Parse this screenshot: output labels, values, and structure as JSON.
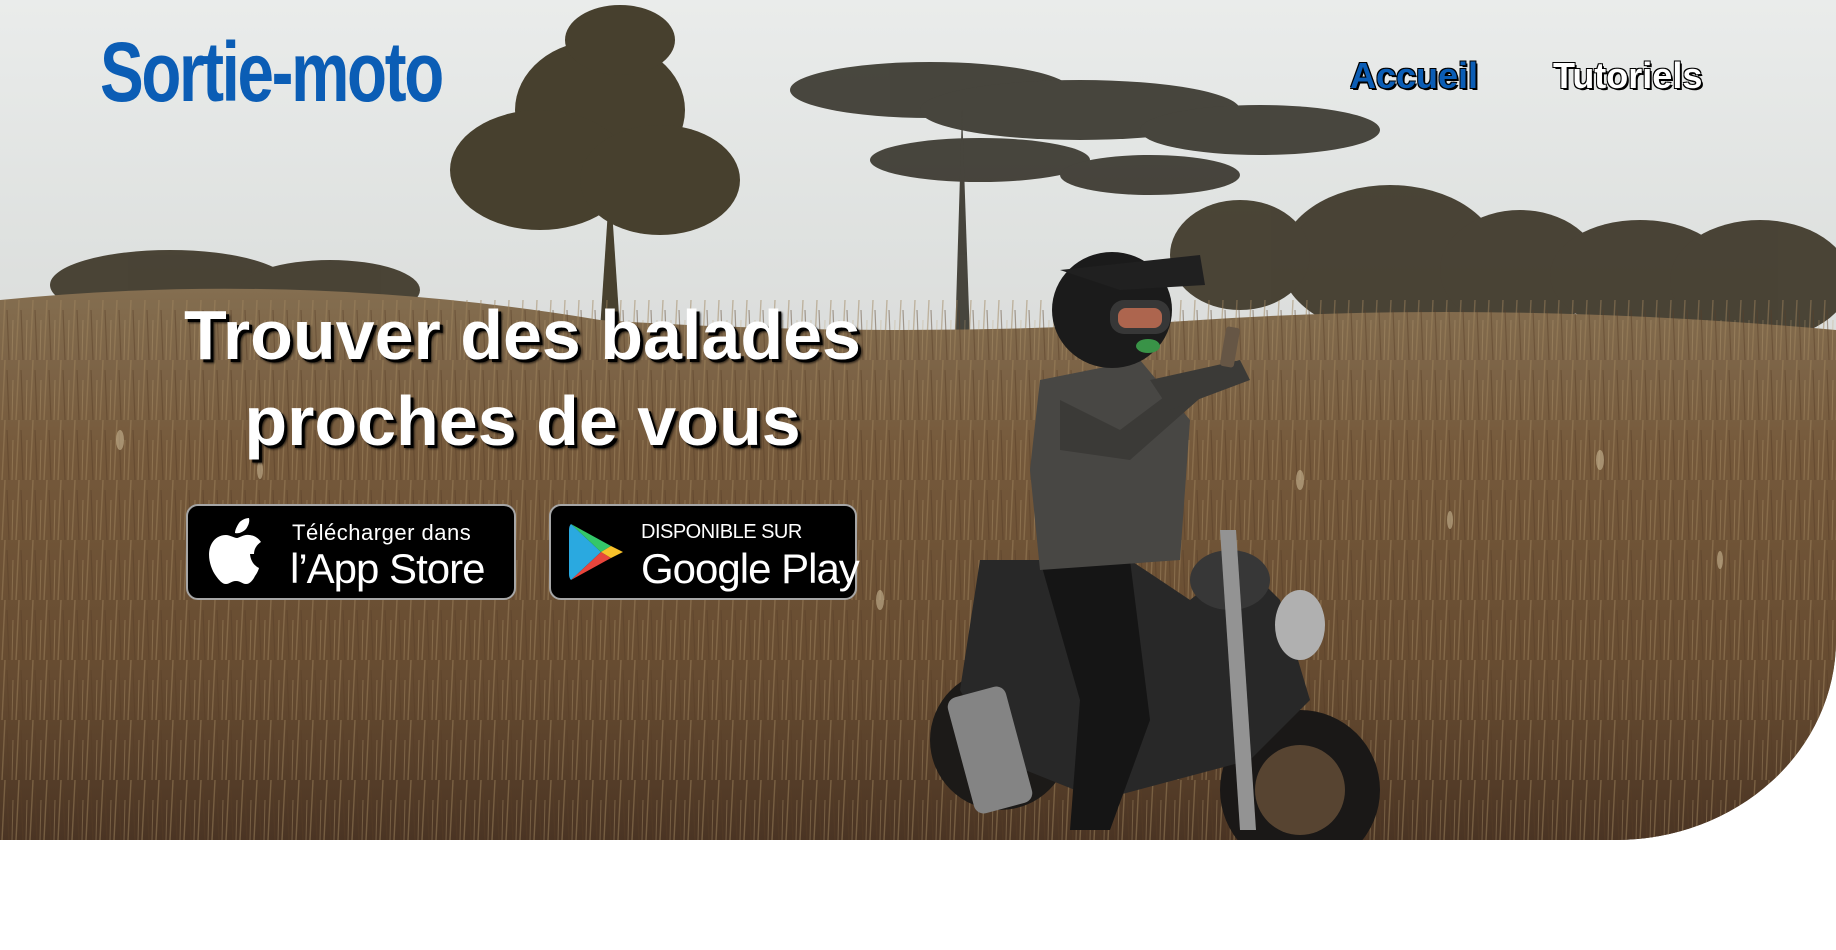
{
  "brand": {
    "name": "Sortie-moto",
    "color": "#0b5db5"
  },
  "nav": {
    "items": [
      {
        "label": "Accueil",
        "active": true
      },
      {
        "label": "Tutoriels",
        "active": false
      }
    ]
  },
  "hero": {
    "headline_line1": "Trouver des balades",
    "headline_line2": "proches de vous",
    "background": "motorcyclist-in-tall-grass-photo"
  },
  "badges": {
    "appstore": {
      "small": "Télécharger dans",
      "big": "l’App Store",
      "icon": "apple-icon"
    },
    "playstore": {
      "small": "DISPONIBLE SUR",
      "big": "Google Play",
      "icon": "google-play-icon"
    }
  }
}
